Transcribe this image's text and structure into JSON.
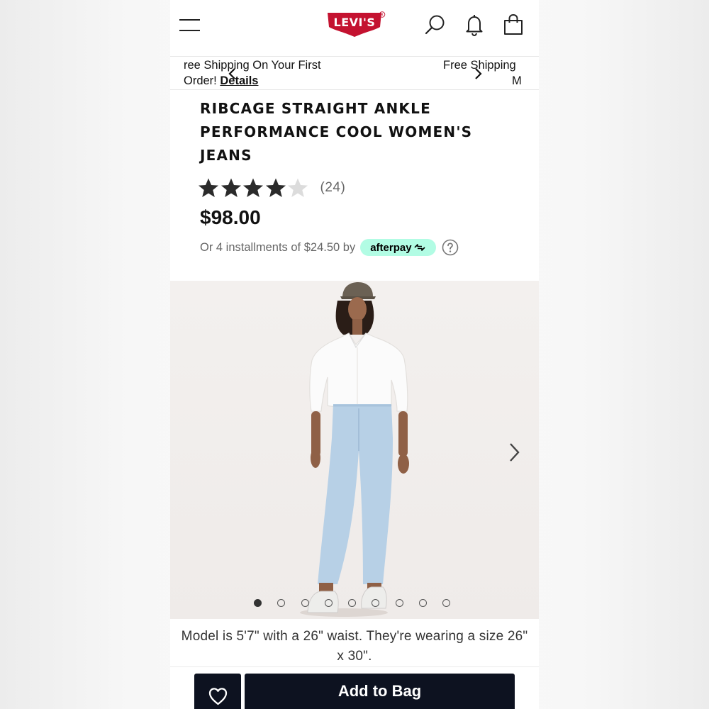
{
  "header": {
    "brand": "LEVI'S",
    "icons": {
      "menu": "hamburger-menu-icon",
      "search": "search-icon",
      "notifications": "bell-icon",
      "bag": "shopping-bag-icon"
    }
  },
  "promo": {
    "slide_a_line1": "ree Shipping On Your First",
    "slide_a_line2": "Order!",
    "details_link": "Details",
    "slide_b_line1": "Free Shipping",
    "slide_b_line2": "M"
  },
  "product": {
    "title": "RIBCAGE STRAIGHT ANKLE PERFORMANCE COOL WOMEN'S JEANS",
    "rating": 4,
    "rating_max": 5,
    "review_count": "(24)",
    "price": "$98.00",
    "installments_text": "Or 4 installments of $24.50 by",
    "afterpay_label": "afterpay"
  },
  "gallery": {
    "image_count": 9,
    "active_index": 0
  },
  "model_info": "Model is 5'7\" with a 26\" waist. They're wearing a size 26\" x 30\".",
  "actions": {
    "add_to_bag_label": "Add to Bag"
  },
  "colors": {
    "brand_red": "#c41230",
    "button_navy": "#0d1220",
    "afterpay_mint": "#b2fce4",
    "star_fill": "#2b2b2b",
    "star_empty": "#dcdcdc"
  }
}
